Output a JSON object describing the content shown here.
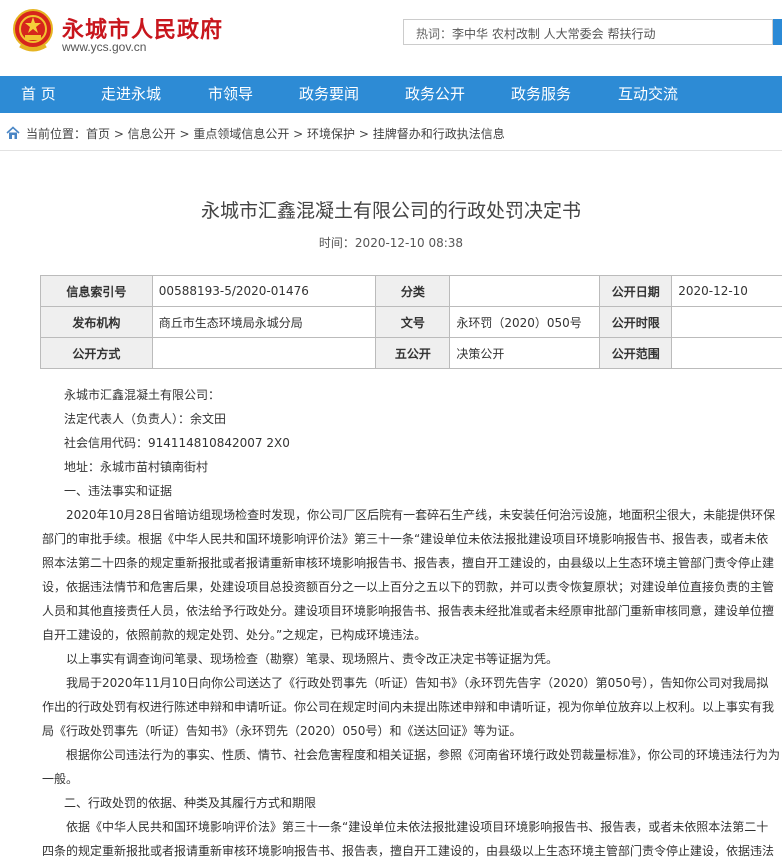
{
  "header": {
    "site_title": "永城市人民政府",
    "site_url": "www.ycs.gov.cn",
    "search_label": "热词：",
    "search_terms": "李中华   农村改制   人大常委会   帮扶行动"
  },
  "nav": {
    "items": [
      "首 页",
      "走进永城",
      "市领导",
      "政务要闻",
      "政务公开",
      "政务服务",
      "互动交流"
    ]
  },
  "breadcrumb": "当前位置：首页 > 信息公开 > 重点领域信息公开 > 环境保护 > 挂牌督办和行政执法信息",
  "article": {
    "title": "永城市汇鑫混凝土有限公司的行政处罚决定书",
    "time": "时间：2020-12-10 08:38"
  },
  "info_table": {
    "labels": {
      "index_no": "信息索引号",
      "category": "分类",
      "pub_date": "公开日期",
      "publisher": "发布机构",
      "doc_no": "文号",
      "pub_period": "公开时限",
      "pub_method": "公开方式",
      "five_open": "五公开",
      "pub_scope": "公开范围"
    },
    "values": {
      "index_no": "00588193-5/2020-01476",
      "category": "",
      "pub_date": "2020-12-10",
      "publisher": "商丘市生态环境局永城分局",
      "doc_no": "永环罚（2020）050号",
      "pub_period": "",
      "pub_method": "",
      "five_open": "决策公开",
      "pub_scope": ""
    }
  },
  "body": {
    "p1": "永城市汇鑫混凝土有限公司：",
    "p2": "法定代表人（负责人）：余文田",
    "p3": "社会信用代码：914114810842007 2X0",
    "p4": "地址：永城市苗村镇南街村",
    "p5": "一、违法事实和证据",
    "p6": "2020年10月28日省暗访组现场检查时发现，你公司厂区后院有一套碎石生产线，未安装任何治污设施，地面积尘很大，未能提供环保部门的审批手续。根据《中华人民共和国环境影响评价法》第三十一条“建设单位未依法报批建设项目环境影响报告书、报告表，或者未依照本法第二十四条的规定重新报批或者报请重新审核环境影响报告书、报告表，擅自开工建设的，由县级以上生态环境主管部门责令停止建设，依据违法情节和危害后果，处建设项目总投资额百分之一以上百分之五以下的罚款，并可以责令恢复原状；对建设单位直接负责的主管人员和其他直接责任人员，依法给予行政处分。建设项目环境影响报告书、报告表未经批准或者未经原审批部门重新审核同意，建设单位擅自开工建设的，依照前款的规定处罚、处分。”之规定，已构成环境违法。",
    "p7": "以上事实有调查询问笔录、现场检查（勘察）笔录、现场照片、责令改正决定书等证据为凭。",
    "p8": "我局于2020年11月10日向你公司送达了《行政处罚事先（听证）告知书》（永环罚先告字（2020）第050号），告知你公司对我局拟作出的行政处罚有权进行陈述申辩和申请听证。你公司在规定时间内未提出陈述申辩和申请听证，视为你单位放弃以上权利。以上事实有我局《行政处罚事先（听证）告知书》（永环罚先（2020）050号）和《送达回证》等为证。",
    "p9": "根据你公司违法行为的事实、性质、情节、社会危害程度和相关证据，参照《河南省环境行政处罚裁量标准》，你公司的环境违法行为为一般。",
    "p10": "二、行政处罚的依据、种类及其履行方式和期限",
    "p11": "依据《中华人民共和国环境影响评价法》第三十一条“建设单位未依法报批建设项目环境影响报告书、报告表，或者未依照本法第二十四条的规定重新报批或者报请重新审核环境影响报告书、报告表，擅自开工建设的，由县级以上生态环境主管部门责令停止建设，依据违法"
  },
  "colors": {
    "brand_red": "#c8161d",
    "nav_blue": "#2d8bd5"
  }
}
